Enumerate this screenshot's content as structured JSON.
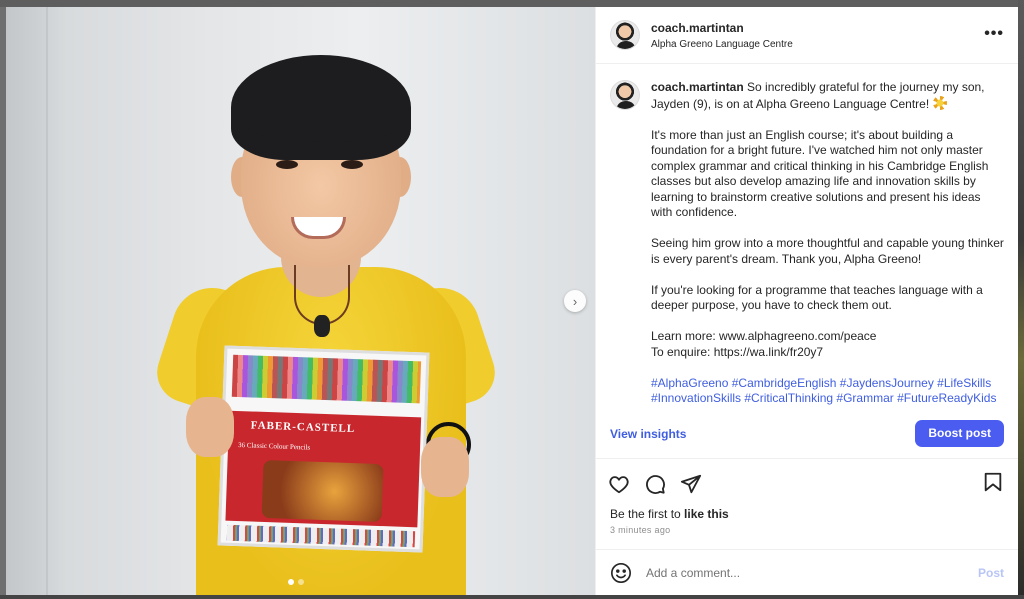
{
  "post": {
    "username": "coach.martintan",
    "location": "Alpha Greeno Language Centre",
    "more_icon": "more-horizontal-icon",
    "image_alt": "Boy in yellow shirt holding a box of Faber-Castell colour pencils",
    "product_brand": "FABER-CASTELL",
    "product_sub": "36 Classic Colour Pencils",
    "carousel": {
      "current": 1,
      "total": 2
    }
  },
  "caption": {
    "username": "coach.martintan",
    "p1": "So incredibly grateful for the journey my son, Jayden (9), is on at Alpha Greeno Language Centre!",
    "p2": "It's more than just an English course; it's about building a foundation for a bright future. I've watched him not only master complex grammar and critical thinking in his Cambridge English classes but also develop amazing life and innovation skills by learning to brainstorm creative solutions and present his ideas with confidence.",
    "p3": "Seeing him grow into a more thoughtful and capable young thinker is every parent's dream. Thank you, Alpha Greeno!",
    "p4": "If you're looking for a programme that teaches language with a deeper purpose, you have to check them out.",
    "learn_more": "Learn more: www.alphagreeno.com/peace",
    "enquire": "To enquire: https://wa.link/fr20y7",
    "hashtags": "#AlphaGreeno #CambridgeEnglish #JaydensJourney #LifeSkills #InnovationSkills #CriticalThinking #Grammar #FutureReadyKids #LanguageWithPurpose #Grateful #ParentingWin #AiforKids"
  },
  "insights": {
    "view_label": "View insights",
    "boost_label": "Boost post"
  },
  "actions": {
    "icons": [
      "heart-icon",
      "comment-icon",
      "share-icon",
      "bookmark-icon"
    ]
  },
  "likes": {
    "prefix": "Be the first to",
    "cta": "like this"
  },
  "timestamp": "3 minutes ago",
  "comment": {
    "placeholder": "Add a comment...",
    "post_label": "Post"
  },
  "colors": {
    "accent": "#4a5df0",
    "link": "#3f5ee0",
    "shirt": "#f0cc2c"
  }
}
